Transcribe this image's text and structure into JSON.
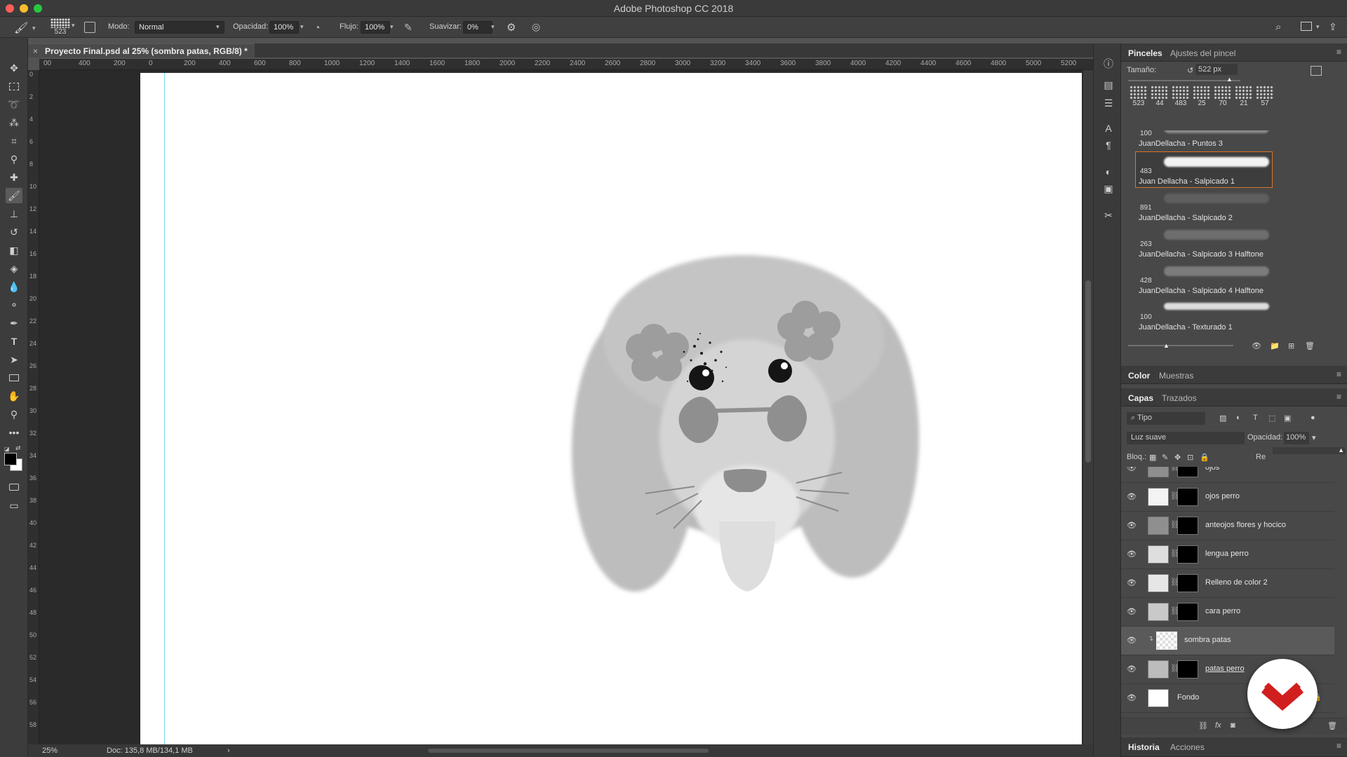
{
  "app": {
    "title": "Adobe Photoshop CC 2018"
  },
  "options_bar": {
    "brush_size": "523",
    "mode_label": "Modo:",
    "mode_value": "Normal",
    "opacity_label": "Opacidad:",
    "opacity_value": "100%",
    "flow_label": "Flujo:",
    "flow_value": "100%",
    "smoothing_label": "Suavizar:",
    "smoothing_value": "0%"
  },
  "document": {
    "tab_title": "Proyecto Final.psd al 25% (sombra patas, RGB/8) *"
  },
  "ruler": {
    "h_ticks": [
      "00",
      "400",
      "200",
      "0",
      "200",
      "400",
      "600",
      "800",
      "1000",
      "1200",
      "1400",
      "1600",
      "1800",
      "2000",
      "2200",
      "2400",
      "2600",
      "2800",
      "3000",
      "3200",
      "3400",
      "3600",
      "3800",
      "4000",
      "4200",
      "4400",
      "4600",
      "4800",
      "5000",
      "5200"
    ],
    "v_ticks": [
      "0",
      "2",
      "4",
      "6",
      "8",
      "10",
      "12",
      "14",
      "16",
      "18",
      "20",
      "22",
      "24",
      "26",
      "28",
      "30",
      "32",
      "34",
      "36",
      "38",
      "40",
      "42",
      "44",
      "46",
      "48",
      "50",
      "52",
      "54",
      "56",
      "58"
    ]
  },
  "status": {
    "zoom": "25%",
    "doc_info": "Doc: 135,8 MB/134,1 MB"
  },
  "brushes_panel": {
    "tabs": [
      "Pinceles",
      "Ajustes del pincel"
    ],
    "size_label": "Tamaño:",
    "size_value": "522 px",
    "recent_tips": [
      "523",
      "44",
      "483",
      "25",
      "70",
      "21",
      "57"
    ],
    "list": [
      {
        "size": "100",
        "name": "JuanDellacha - Puntos 3"
      },
      {
        "size": "483",
        "name": "Juan Dellacha - Salpicado 1",
        "selected": true
      },
      {
        "size": "891",
        "name": "JuanDellacha - Salpicado 2"
      },
      {
        "size": "263",
        "name": "JuanDellacha - Salpicado 3 Halftone"
      },
      {
        "size": "428",
        "name": "JuanDellacha - Salpicado 4 Halftone"
      },
      {
        "size": "100",
        "name": "JuanDellacha - Texturado 1"
      }
    ]
  },
  "color_panel": {
    "tabs": [
      "Color",
      "Muestras"
    ]
  },
  "layers_panel": {
    "tabs": [
      "Capas",
      "Trazados"
    ],
    "filter": "Tipo",
    "blend_mode": "Luz suave",
    "opacity_label": "Opacidad:",
    "opacity_value": "100%",
    "lock_label": "Bloq.:",
    "fill_label": "Re",
    "layers": [
      {
        "name": "ojos"
      },
      {
        "name": "ojos perro"
      },
      {
        "name": "anteojos flores y hocico"
      },
      {
        "name": "lengua perro"
      },
      {
        "name": "Relleno de color 2"
      },
      {
        "name": "cara perro"
      },
      {
        "name": "sombra patas",
        "selected": true
      },
      {
        "name": "patas perro"
      },
      {
        "name": "Fondo"
      }
    ]
  },
  "history_panel": {
    "tabs": [
      "Historia",
      "Acciones"
    ]
  },
  "colors": {
    "accent_selection": "#d9752e",
    "logo_red": "#d11f1f",
    "guide": "#6fd8f0"
  },
  "icons": [
    "move-icon",
    "marquee-icon",
    "lasso-icon",
    "magic-wand-icon",
    "crop-icon",
    "eyedropper-icon",
    "healing-icon",
    "brush-icon",
    "stamp-icon",
    "history-brush-icon",
    "eraser-icon",
    "bucket-icon",
    "blur-icon",
    "dodge-icon",
    "pen-icon",
    "type-icon",
    "path-select-icon",
    "rectangle-icon",
    "hand-icon",
    "zoom-icon",
    "more-icon"
  ]
}
